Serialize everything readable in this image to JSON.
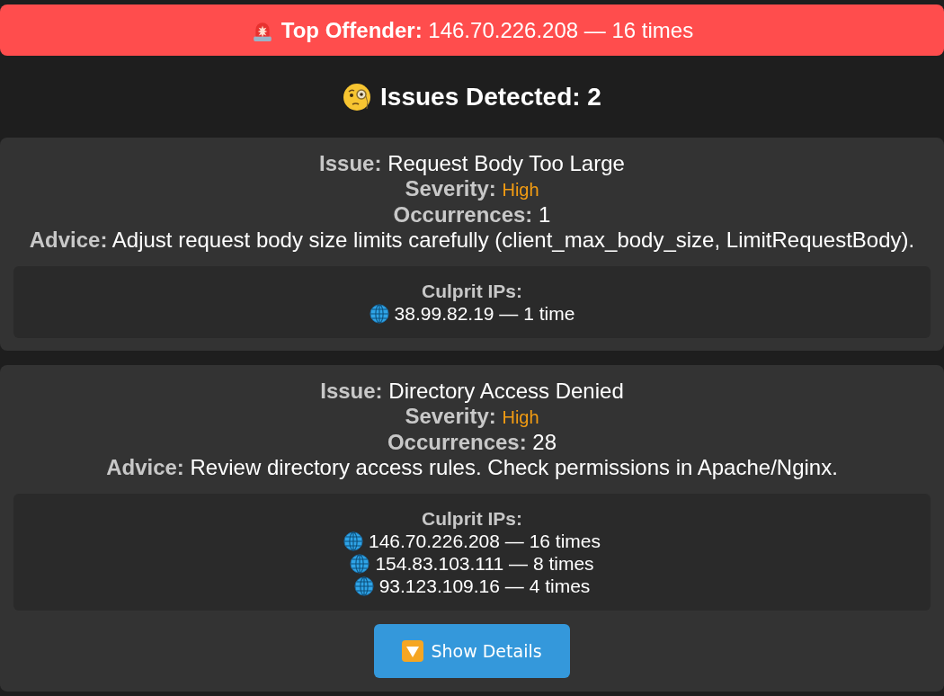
{
  "alert_banner": {
    "label": "Top Offender:",
    "value": "146.70.226.208 — 16 times"
  },
  "heading": "Issues Detected: 2",
  "issues": [
    {
      "fields": [
        {
          "kind": "text",
          "label": "Issue:",
          "value": "Request Body Too Large"
        },
        {
          "kind": "severity",
          "label": "Severity:",
          "value": "High",
          "color": "#f39c12"
        },
        {
          "kind": "text",
          "label": "Occurrences:",
          "value": "1"
        },
        {
          "kind": "text",
          "label": "Advice:",
          "value": "Adjust request body size limits carefully (client_max_body_size, LimitRequestBody)."
        }
      ],
      "culprits": {
        "title": "Culprit IPs:",
        "ips": [
          "38.99.82.19 — 1 time"
        ]
      }
    },
    {
      "fields": [
        {
          "kind": "text",
          "label": "Issue:",
          "value": "Directory Access Denied"
        },
        {
          "kind": "severity",
          "label": "Severity:",
          "value": "High",
          "color": "#f39c12"
        },
        {
          "kind": "text",
          "label": "Occurrences:",
          "value": "28"
        },
        {
          "kind": "text",
          "label": "Advice:",
          "value": "Review directory access rules. Check permissions in Apache/Nginx."
        }
      ],
      "culprits": {
        "title": "Culprit IPs:",
        "ips": [
          "146.70.226.208 — 16 times",
          "154.83.103.111 — 8 times",
          "93.123.109.16 — 4 times"
        ]
      },
      "details_button": {
        "label": "Show Details"
      }
    }
  ]
}
